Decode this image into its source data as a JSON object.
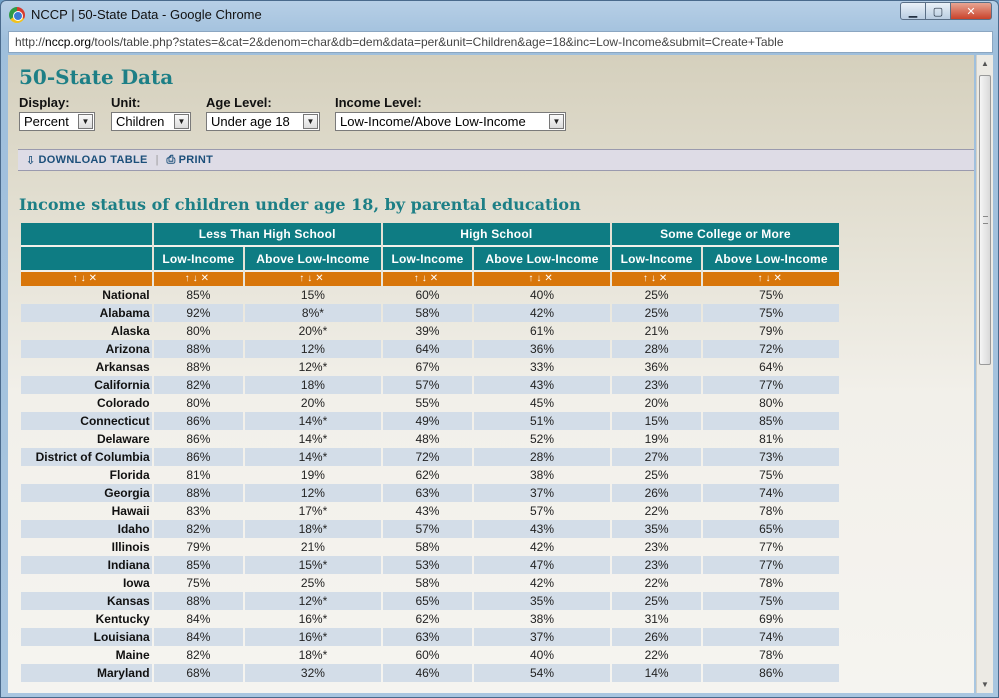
{
  "window": {
    "title": "NCCP | 50-State Data - Google Chrome",
    "url_prefix": "http://",
    "url_host": "nccp.org",
    "url_rest": "/tools/table.php?states=&cat=2&denom=char&db=dem&data=per&unit=Children&age=18&inc=Low-Income&submit=Create+Table"
  },
  "page": {
    "title": "50-State Data",
    "controls": [
      {
        "label": "Display:",
        "value": "Percent"
      },
      {
        "label": "Unit:",
        "value": "Children"
      },
      {
        "label": "Age Level:",
        "value": "Under age 18"
      },
      {
        "label": "Income Level:",
        "value": "Low-Income/Above Low-Income"
      }
    ],
    "toolbar": {
      "download": "DOWNLOAD TABLE",
      "separator": "|",
      "print": "PRINT"
    },
    "table_title": "Income status of children under age 18, by parental education"
  },
  "table": {
    "groups": [
      "Less Than High School",
      "High School",
      "Some College or More"
    ],
    "subheaders": [
      "Low-Income",
      "Above Low-Income",
      "Low-Income",
      "Above Low-Income",
      "Low-Income",
      "Above Low-Income"
    ],
    "sort_controls": "↑↓✕",
    "rows": [
      {
        "state": "National",
        "values": [
          "85%",
          "15%",
          "60%",
          "40%",
          "25%",
          "75%"
        ]
      },
      {
        "state": "Alabama",
        "values": [
          "92%",
          "8%*",
          "58%",
          "42%",
          "25%",
          "75%"
        ]
      },
      {
        "state": "Alaska",
        "values": [
          "80%",
          "20%*",
          "39%",
          "61%",
          "21%",
          "79%"
        ]
      },
      {
        "state": "Arizona",
        "values": [
          "88%",
          "12%",
          "64%",
          "36%",
          "28%",
          "72%"
        ]
      },
      {
        "state": "Arkansas",
        "values": [
          "88%",
          "12%*",
          "67%",
          "33%",
          "36%",
          "64%"
        ]
      },
      {
        "state": "California",
        "values": [
          "82%",
          "18%",
          "57%",
          "43%",
          "23%",
          "77%"
        ]
      },
      {
        "state": "Colorado",
        "values": [
          "80%",
          "20%",
          "55%",
          "45%",
          "20%",
          "80%"
        ]
      },
      {
        "state": "Connecticut",
        "values": [
          "86%",
          "14%*",
          "49%",
          "51%",
          "15%",
          "85%"
        ]
      },
      {
        "state": "Delaware",
        "values": [
          "86%",
          "14%*",
          "48%",
          "52%",
          "19%",
          "81%"
        ]
      },
      {
        "state": "District of Columbia",
        "values": [
          "86%",
          "14%*",
          "72%",
          "28%",
          "27%",
          "73%"
        ]
      },
      {
        "state": "Florida",
        "values": [
          "81%",
          "19%",
          "62%",
          "38%",
          "25%",
          "75%"
        ]
      },
      {
        "state": "Georgia",
        "values": [
          "88%",
          "12%",
          "63%",
          "37%",
          "26%",
          "74%"
        ]
      },
      {
        "state": "Hawaii",
        "values": [
          "83%",
          "17%*",
          "43%",
          "57%",
          "22%",
          "78%"
        ]
      },
      {
        "state": "Idaho",
        "values": [
          "82%",
          "18%*",
          "57%",
          "43%",
          "35%",
          "65%"
        ]
      },
      {
        "state": "Illinois",
        "values": [
          "79%",
          "21%",
          "58%",
          "42%",
          "23%",
          "77%"
        ]
      },
      {
        "state": "Indiana",
        "values": [
          "85%",
          "15%*",
          "53%",
          "47%",
          "23%",
          "77%"
        ]
      },
      {
        "state": "Iowa",
        "values": [
          "75%",
          "25%",
          "58%",
          "42%",
          "22%",
          "78%"
        ]
      },
      {
        "state": "Kansas",
        "values": [
          "88%",
          "12%*",
          "65%",
          "35%",
          "25%",
          "75%"
        ]
      },
      {
        "state": "Kentucky",
        "values": [
          "84%",
          "16%*",
          "62%",
          "38%",
          "31%",
          "69%"
        ]
      },
      {
        "state": "Louisiana",
        "values": [
          "84%",
          "16%*",
          "63%",
          "37%",
          "26%",
          "74%"
        ]
      },
      {
        "state": "Maine",
        "values": [
          "82%",
          "18%*",
          "60%",
          "40%",
          "22%",
          "78%"
        ]
      },
      {
        "state": "Maryland",
        "values": [
          "68%",
          "32%",
          "46%",
          "54%",
          "14%",
          "86%"
        ]
      }
    ]
  }
}
